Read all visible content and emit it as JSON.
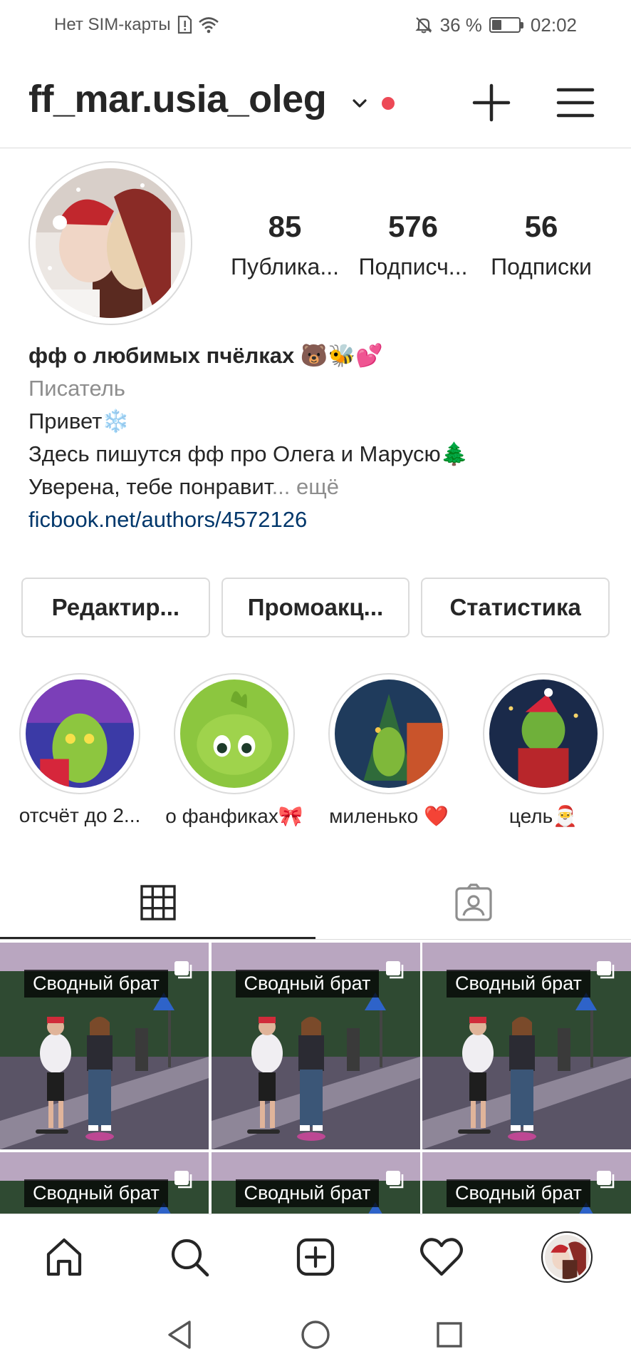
{
  "status_bar": {
    "carrier": "Нет SIM-карты",
    "battery": "36 %",
    "battery_level": 0.36,
    "time": "02:02"
  },
  "header": {
    "username": "ff_mar.usia_oleg",
    "icons": [
      "chevron-down-icon",
      "notification-dot",
      "plus-icon",
      "hamburger-menu-icon"
    ]
  },
  "profile": {
    "stats": [
      {
        "value": "85",
        "label": "Публика..."
      },
      {
        "value": "576",
        "label": "Подписч..."
      },
      {
        "value": "56",
        "label": "Подписки"
      }
    ],
    "name": "фф о любимых пчёлках 🐻🐝💕",
    "category": "Писатель",
    "bio_line1": "Привет❄️",
    "bio_line2": "Здесь пишутся фф про Олега и Марусю🌲",
    "bio_line3": "Уверена, тебе понравит",
    "bio_more": "... ещё",
    "link": "ficbook.net/authors/4572126"
  },
  "actions": {
    "edit": "Редактир...",
    "promo": "Промоакц...",
    "stats": "Статистика"
  },
  "highlights": [
    {
      "label": "отсчёт до 2..."
    },
    {
      "label": "о фанфиках🎀"
    },
    {
      "label": "миленько ❤️"
    },
    {
      "label": "цель🎅"
    }
  ],
  "tabs": {
    "icons": [
      "grid-icon",
      "tagged-icon"
    ],
    "active": 0
  },
  "posts": [
    {
      "caption": "Сводный брат"
    },
    {
      "caption": "Сводный брат"
    },
    {
      "caption": "Сводный брат"
    },
    {
      "caption": "Сводный брат"
    },
    {
      "caption": "Сводный брат"
    },
    {
      "caption": "Сводный брат"
    }
  ],
  "bottom_nav": {
    "icons": [
      "home-icon",
      "search-icon",
      "new-post-icon",
      "activity-heart-icon",
      "profile-avatar"
    ]
  },
  "system_nav": {
    "icons": [
      "back-icon",
      "home-circle-icon",
      "recents-icon"
    ]
  },
  "colors": {
    "text": "#262626",
    "secondary": "#8e8e8e",
    "link": "#00376b",
    "border": "#dbdbdb",
    "notification": "#ed4956"
  }
}
